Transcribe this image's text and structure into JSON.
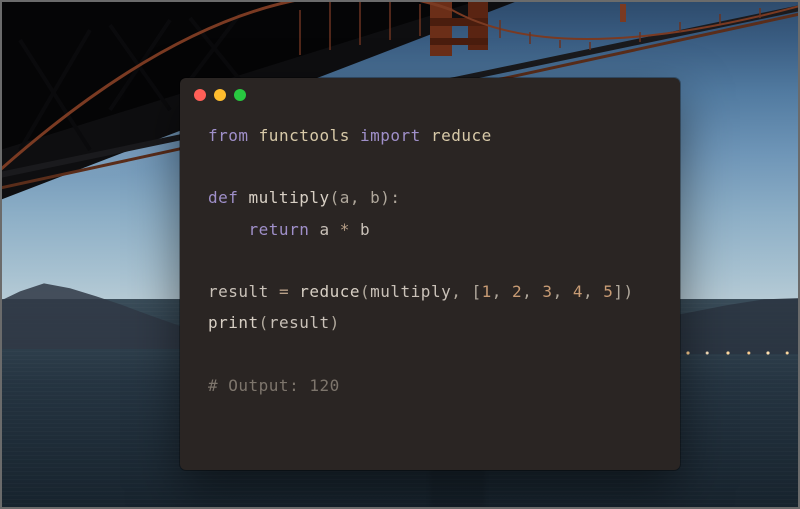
{
  "window": {
    "traffic_light_colors": {
      "close": "#ff5f57",
      "minimize": "#febc2e",
      "zoom": "#28c840"
    }
  },
  "code": {
    "l1_from": "from ",
    "l1_mod": "functools ",
    "l1_import": "import ",
    "l1_target": "reduce",
    "l3_def": "def ",
    "l3_fn": "multiply",
    "l3_sig": "(a, b):",
    "l4_indent": "    ",
    "l4_return": "return ",
    "l4_expr_a": "a ",
    "l4_op": "* ",
    "l4_expr_b": "b",
    "l6_lhs": "result ",
    "l6_assign": "= ",
    "l6_call": "reduce",
    "l6_open": "(",
    "l6_arg1": "multiply",
    "l6_comma": ", [",
    "l6_n1": "1",
    "l6_c1": ", ",
    "l6_n2": "2",
    "l6_c2": ", ",
    "l6_n3": "3",
    "l6_c3": ", ",
    "l6_n4": "4",
    "l6_c4": ", ",
    "l6_n5": "5",
    "l6_close": "])",
    "l7_print": "print",
    "l7_open": "(",
    "l7_arg": "result",
    "l7_close": ")",
    "l9_comment": "# Output: 120"
  }
}
